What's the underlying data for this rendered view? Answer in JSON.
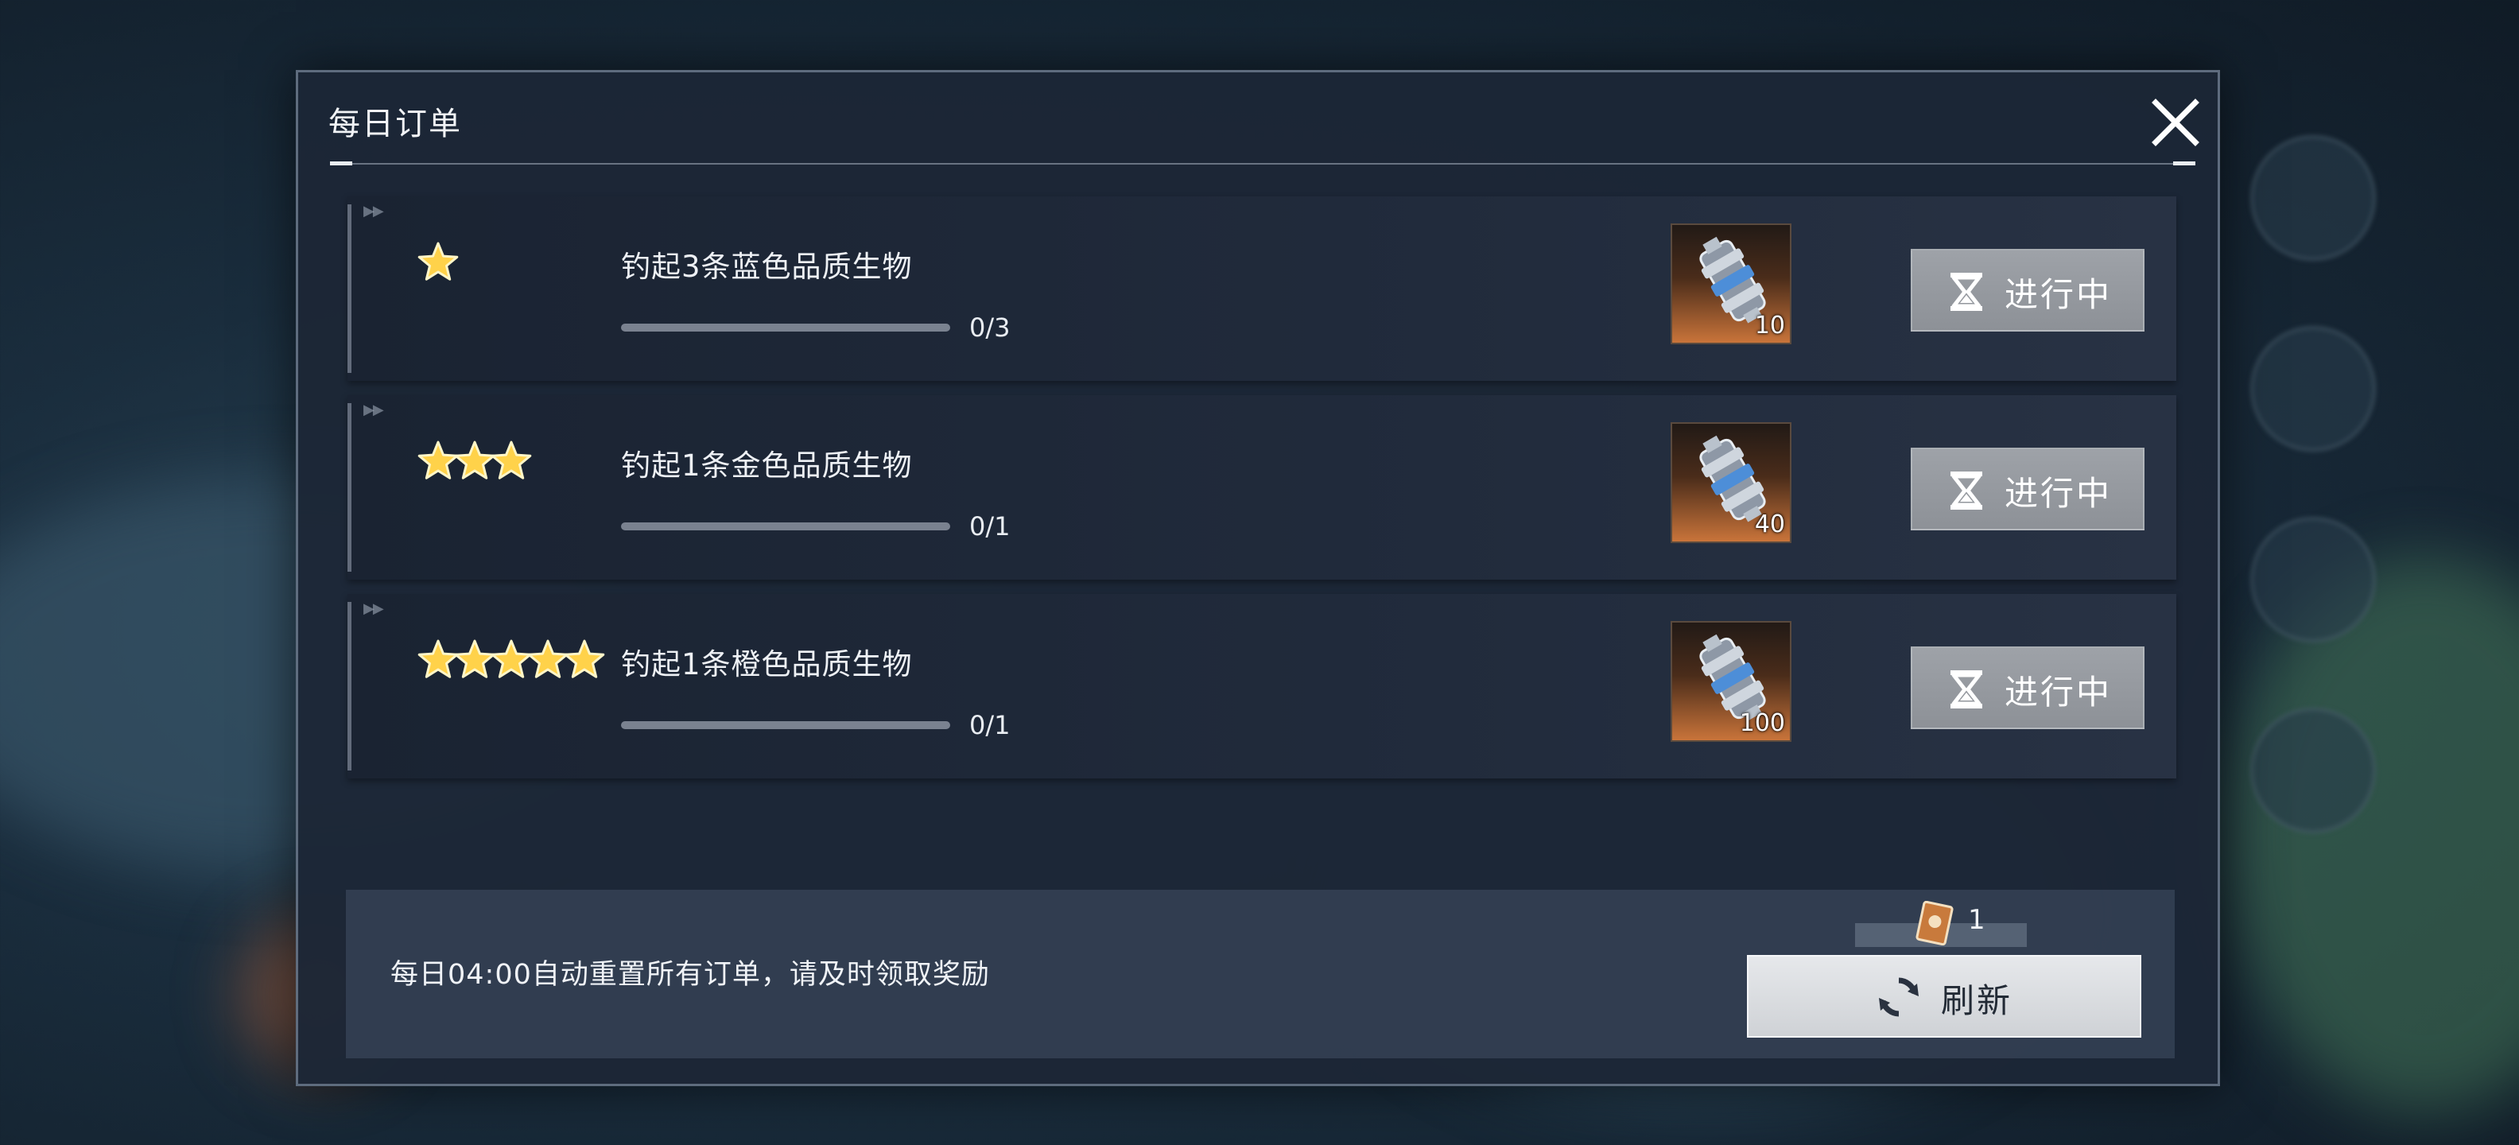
{
  "dialog": {
    "title": "每日订单"
  },
  "orders": [
    {
      "stars": 1,
      "title": "钓起3条蓝色品质生物",
      "progress_text": "0/3",
      "progress_fraction": 0,
      "reward_count": "10",
      "status_label": "进行中"
    },
    {
      "stars": 3,
      "title": "钓起1条金色品质生物",
      "progress_text": "0/1",
      "progress_fraction": 0,
      "reward_count": "40",
      "status_label": "进行中"
    },
    {
      "stars": 5,
      "title": "钓起1条橙色品质生物",
      "progress_text": "0/1",
      "progress_fraction": 0,
      "reward_count": "100",
      "status_label": "进行中"
    }
  ],
  "footer": {
    "notice": "每日04:00自动重置所有订单，请及时领取奖励",
    "refresh_cost": "1",
    "refresh_label": "刷新"
  },
  "icons": {
    "close": "close-icon",
    "star": "star-icon",
    "reward": "gear-part-icon",
    "status": "hourglass-icon",
    "ticket": "ticket-icon",
    "refresh": "refresh-icon"
  },
  "colors": {
    "star": "#ffd24a",
    "status_button": "#9a9ea4",
    "refresh_button": "#dcdfe3",
    "reward_bg": "#c9743a"
  }
}
